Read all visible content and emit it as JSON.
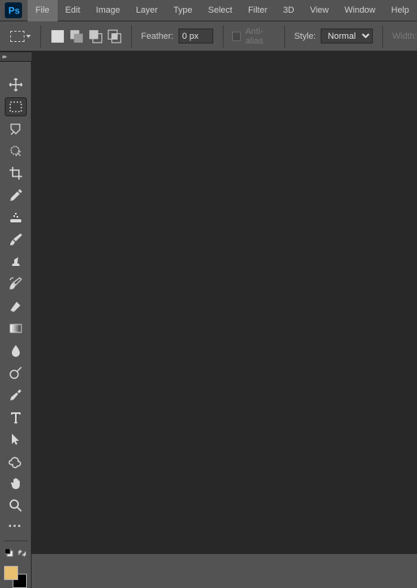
{
  "app": {
    "name": "Photoshop"
  },
  "menu": {
    "items": [
      "File",
      "Edit",
      "Image",
      "Layer",
      "Type",
      "Select",
      "Filter",
      "3D",
      "View",
      "Window",
      "Help"
    ],
    "active_index": 0
  },
  "options": {
    "feather_label": "Feather:",
    "feather_value": "0 px",
    "antialias_label": "Anti-alias",
    "antialias_checked": false,
    "style_label": "Style:",
    "style_value": "Normal",
    "width_label": "Width:"
  },
  "tools": [
    {
      "id": "move-tool",
      "active": false
    },
    {
      "id": "rectangular-marquee-tool",
      "active": true
    },
    {
      "id": "lasso-tool",
      "active": false
    },
    {
      "id": "quick-selection-tool",
      "active": false
    },
    {
      "id": "crop-tool",
      "active": false
    },
    {
      "id": "eyedropper-tool",
      "active": false
    },
    {
      "id": "spot-healing-brush-tool",
      "active": false
    },
    {
      "id": "brush-tool",
      "active": false
    },
    {
      "id": "clone-stamp-tool",
      "active": false
    },
    {
      "id": "history-brush-tool",
      "active": false
    },
    {
      "id": "eraser-tool",
      "active": false
    },
    {
      "id": "gradient-tool",
      "active": false
    },
    {
      "id": "blur-tool",
      "active": false
    },
    {
      "id": "dodge-tool",
      "active": false
    },
    {
      "id": "pen-tool",
      "active": false
    },
    {
      "id": "type-tool",
      "active": false
    },
    {
      "id": "path-selection-tool",
      "active": false
    },
    {
      "id": "custom-shape-tool",
      "active": false
    },
    {
      "id": "hand-tool",
      "active": false
    },
    {
      "id": "zoom-tool",
      "active": false
    }
  ],
  "colors": {
    "foreground": "#e9c070",
    "background": "#000000"
  }
}
